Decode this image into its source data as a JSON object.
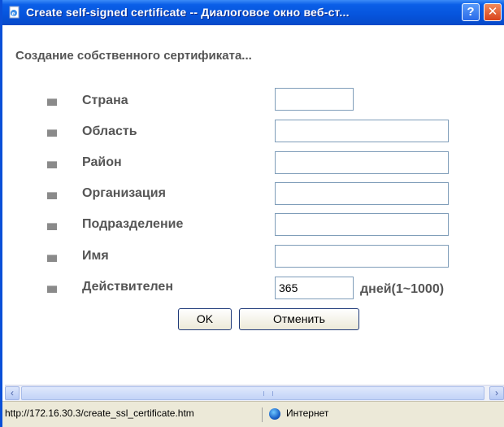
{
  "window": {
    "title": "Create self-signed certificate -- Диалоговое окно веб-ст...",
    "help_label": "?",
    "close_label": "✕"
  },
  "form": {
    "heading": "Создание собственного сертификата...",
    "fields": [
      {
        "label": "Страна",
        "value": ""
      },
      {
        "label": "Область",
        "value": ""
      },
      {
        "label": "Район",
        "value": ""
      },
      {
        "label": "Организация",
        "value": ""
      },
      {
        "label": "Подразделение",
        "value": ""
      },
      {
        "label": "Имя",
        "value": ""
      },
      {
        "label": "Действителен",
        "value": "365"
      }
    ],
    "validity_suffix": "дней(1~1000)",
    "ok_label": "OK",
    "cancel_label": "Отменить"
  },
  "scrollbar": {
    "left_arrow": "‹",
    "right_arrow": "›"
  },
  "statusbar": {
    "url": "http://172.16.30.3/create_ssl_certificate.htm",
    "zone": "Интернет"
  },
  "icons": {
    "window_icon": "ie-page-icon",
    "zone_icon": "globe-icon"
  },
  "colors": {
    "titlebar": "#0654dc",
    "label_text": "#555555",
    "field_border": "#7f9db9"
  }
}
